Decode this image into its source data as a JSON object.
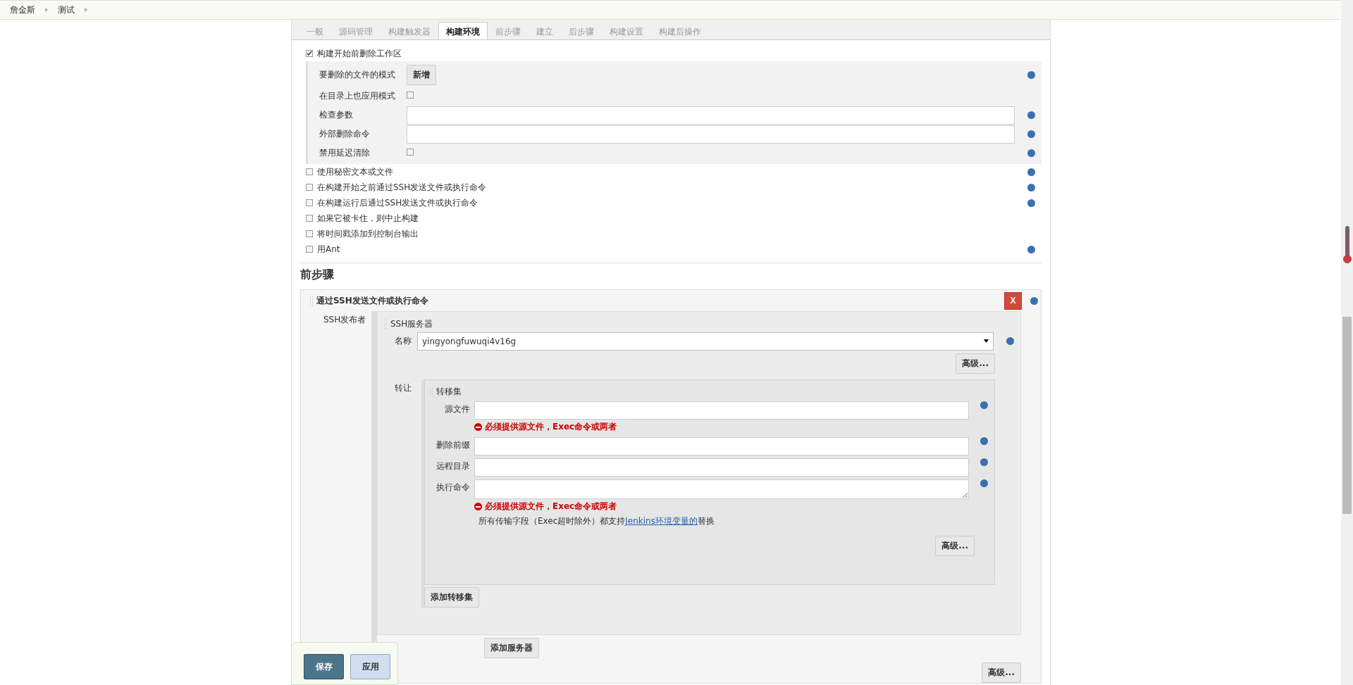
{
  "breadcrumbs": [
    "詹金斯",
    "测试"
  ],
  "tabs": [
    {
      "label": "一般",
      "selected": false
    },
    {
      "label": "源码管理",
      "selected": false
    },
    {
      "label": "构建触发器",
      "selected": false
    },
    {
      "label": "构建环境",
      "selected": true
    },
    {
      "label": "前步骤",
      "selected": false
    },
    {
      "label": "建立",
      "selected": false
    },
    {
      "label": "后步骤",
      "selected": false
    },
    {
      "label": "构建设置",
      "selected": false
    },
    {
      "label": "构建后操作",
      "selected": false
    }
  ],
  "workspace_cleanup": {
    "label": "构建开始前删除工作区",
    "checked": true,
    "fields": [
      {
        "kind": "button",
        "label": "要删除的文件的模式",
        "button": "新增",
        "help": true
      },
      {
        "kind": "checkbox",
        "label": "在目录上也应用模式",
        "checked": false,
        "help": false
      },
      {
        "kind": "text",
        "label": "检查参数",
        "help": true
      },
      {
        "kind": "text",
        "label": "外部删除命令",
        "help": true
      },
      {
        "kind": "checkbox",
        "label": "禁用延迟清除",
        "checked": false,
        "help": true
      }
    ]
  },
  "options": [
    {
      "label": "使用秘密文本或文件",
      "checked": false,
      "help": true
    },
    {
      "label": "在构建开始之前通过SSH发送文件或执行命令",
      "checked": false,
      "help": true
    },
    {
      "label": "在构建运行后通过SSH发送文件或执行命令",
      "checked": false,
      "help": true
    },
    {
      "label": "如果它被卡住，则中止构建",
      "checked": false,
      "help": false
    },
    {
      "label": "将时间戳添加到控制台输出",
      "checked": false,
      "help": false
    },
    {
      "label": "用Ant",
      "checked": false,
      "help": true
    }
  ],
  "pre_steps": {
    "title": "前步骤",
    "step": {
      "title": "通过SSH发送文件或执行命令",
      "delete": "X",
      "publisher_label": "SSH发布者",
      "server_title": "SSH服务器",
      "name_label": "名称",
      "name_value": "yingyongfuwuqi4v16g",
      "advanced": "高级...",
      "transfer_label": "转让",
      "transfer_set_title": "转移集",
      "fields": [
        {
          "kind": "input",
          "label": "源文件",
          "error": "必须提供源文件，Exec命令或两者"
        },
        {
          "kind": "input",
          "label": "删除前缀"
        },
        {
          "kind": "input",
          "label": "远程目录"
        },
        {
          "kind": "textarea",
          "label": "执行命令",
          "error": "必须提供源文件，Exec命令或两者"
        }
      ],
      "note_prefix": "所有传输字段（Exec超时除外）都支持",
      "note_link": "Jenkins环境变量的",
      "note_suffix": "替换",
      "transfer_advanced": "高级...",
      "add_transfer": "添加转移集",
      "add_server": "添加服务器",
      "bottom_advanced": "高级..."
    }
  },
  "footer": {
    "save": "保存",
    "apply": "应用"
  }
}
